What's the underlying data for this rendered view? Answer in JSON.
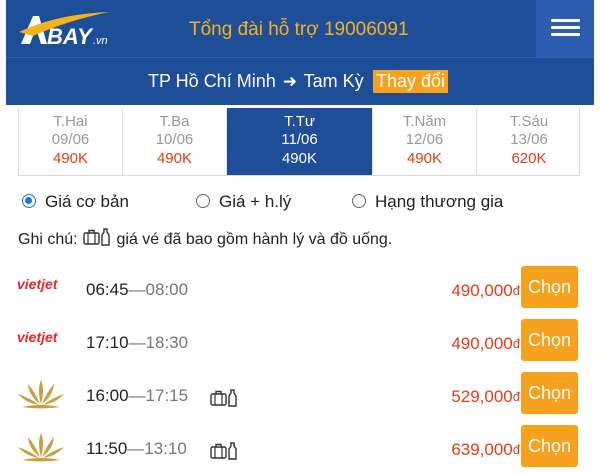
{
  "header": {
    "logo_text": "BAY",
    "logo_suffix": ".vn",
    "hotline": "Tổng đài hỗ trợ 19006091"
  },
  "route": {
    "from": "TP Hồ Chí Minh",
    "to": "Tam Kỳ",
    "change_label": "Thay đổi"
  },
  "dates": [
    {
      "day": "T.Hai",
      "date": "09/06",
      "price": "490K",
      "active": false
    },
    {
      "day": "T.Ba",
      "date": "10/06",
      "price": "490K",
      "active": false
    },
    {
      "day": "T.Tư",
      "date": "11/06",
      "price": "490K",
      "active": true
    },
    {
      "day": "T.Năm",
      "date": "12/06",
      "price": "490K",
      "active": false
    },
    {
      "day": "T.Sáu",
      "date": "13/06",
      "price": "620K",
      "active": false
    }
  ],
  "fare_options": [
    {
      "label": "Giá cơ bản",
      "selected": true
    },
    {
      "label": "Giá + h.lý",
      "selected": false
    },
    {
      "label": "Hạng thương gia",
      "selected": false
    }
  ],
  "note": {
    "prefix": "Ghi chú:",
    "text": "giá vé đã bao gồm hành lý và đồ uống."
  },
  "flights": [
    {
      "airline": "vietjet",
      "airline_logo_text": "vietjet",
      "depart": "06:45",
      "arrive": "08:00",
      "baggage": false,
      "price": "490,000",
      "currency": "đ",
      "button": "Chọn"
    },
    {
      "airline": "vietjet",
      "airline_logo_text": "vietjet",
      "depart": "17:10",
      "arrive": "18:30",
      "baggage": false,
      "price": "490,000",
      "currency": "đ",
      "button": "Chọn"
    },
    {
      "airline": "vietnam-airlines",
      "depart": "16:00",
      "arrive": "17:15",
      "baggage": true,
      "price": "529,000",
      "currency": "đ",
      "button": "Chọn"
    },
    {
      "airline": "vietnam-airlines",
      "depart": "11:50",
      "arrive": "13:10",
      "baggage": true,
      "price": "639,000",
      "currency": "đ",
      "button": "Chọn"
    }
  ],
  "colors": {
    "header_bg": "#1f4e99",
    "accent_orange": "#f6a21e",
    "hotline": "#f6b21b",
    "price_red": "#e23b17",
    "radio_blue": "#1a73e8",
    "vietjet_red": "#e4262b",
    "vna_gold": "#c8a042"
  }
}
